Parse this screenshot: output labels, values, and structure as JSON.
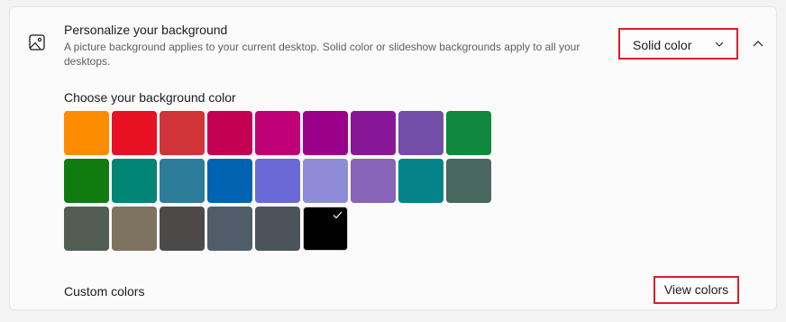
{
  "header": {
    "icon": "picture-icon",
    "title": "Personalize your background",
    "description": "A picture background applies to your current desktop. Solid color or slideshow backgrounds apply to all your desktops.",
    "background_type": {
      "selected": "Solid color",
      "icon": "chevron-down-icon"
    },
    "collapse_icon": "chevron-up-icon"
  },
  "color_picker": {
    "label": "Choose your background color",
    "selected_index": 23,
    "rows": [
      [
        "#ff8c00",
        "#e81123",
        "#d13438",
        "#c30052",
        "#bf0077",
        "#9a0089",
        "#881798",
        "#744da9",
        "#10893e"
      ],
      [
        "#107c10",
        "#018574",
        "#2d7d9a",
        "#0063b1",
        "#6b69d6",
        "#8e8cd8",
        "#8764b8",
        "#038387",
        "#486860"
      ],
      [
        "#525e54",
        "#7e735f",
        "#4c4a48",
        "#515c6b",
        "#4a5459",
        "#000000"
      ]
    ]
  },
  "custom_colors": {
    "label": "Custom colors",
    "button_label": "View colors"
  },
  "colors": {
    "highlight": "#d9202a",
    "card_background": "#fbfbfb",
    "page_background": "#f3f3f3"
  }
}
